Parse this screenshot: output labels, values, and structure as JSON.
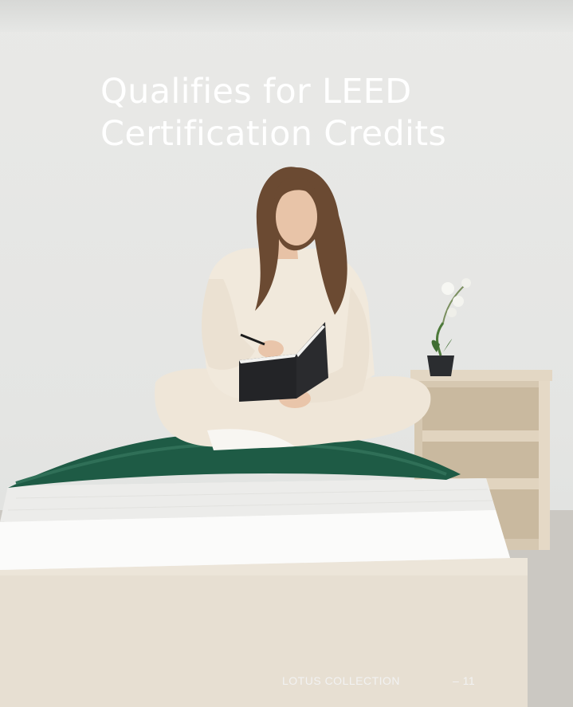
{
  "headline": {
    "line1": "Qualifies for LEED",
    "line2": "Certification Credits"
  },
  "footer": {
    "collection": "LOTUS COLLECTION",
    "page_number": "– 11"
  },
  "photo": {
    "subject": "woman-writing-on-bed-photo",
    "colors": {
      "wall": "#e6e6e4",
      "blanket": "#1f5a45",
      "sweater": "#efe7da",
      "shelf": "#d9cbb5",
      "headline_text": "#ffffff"
    }
  }
}
